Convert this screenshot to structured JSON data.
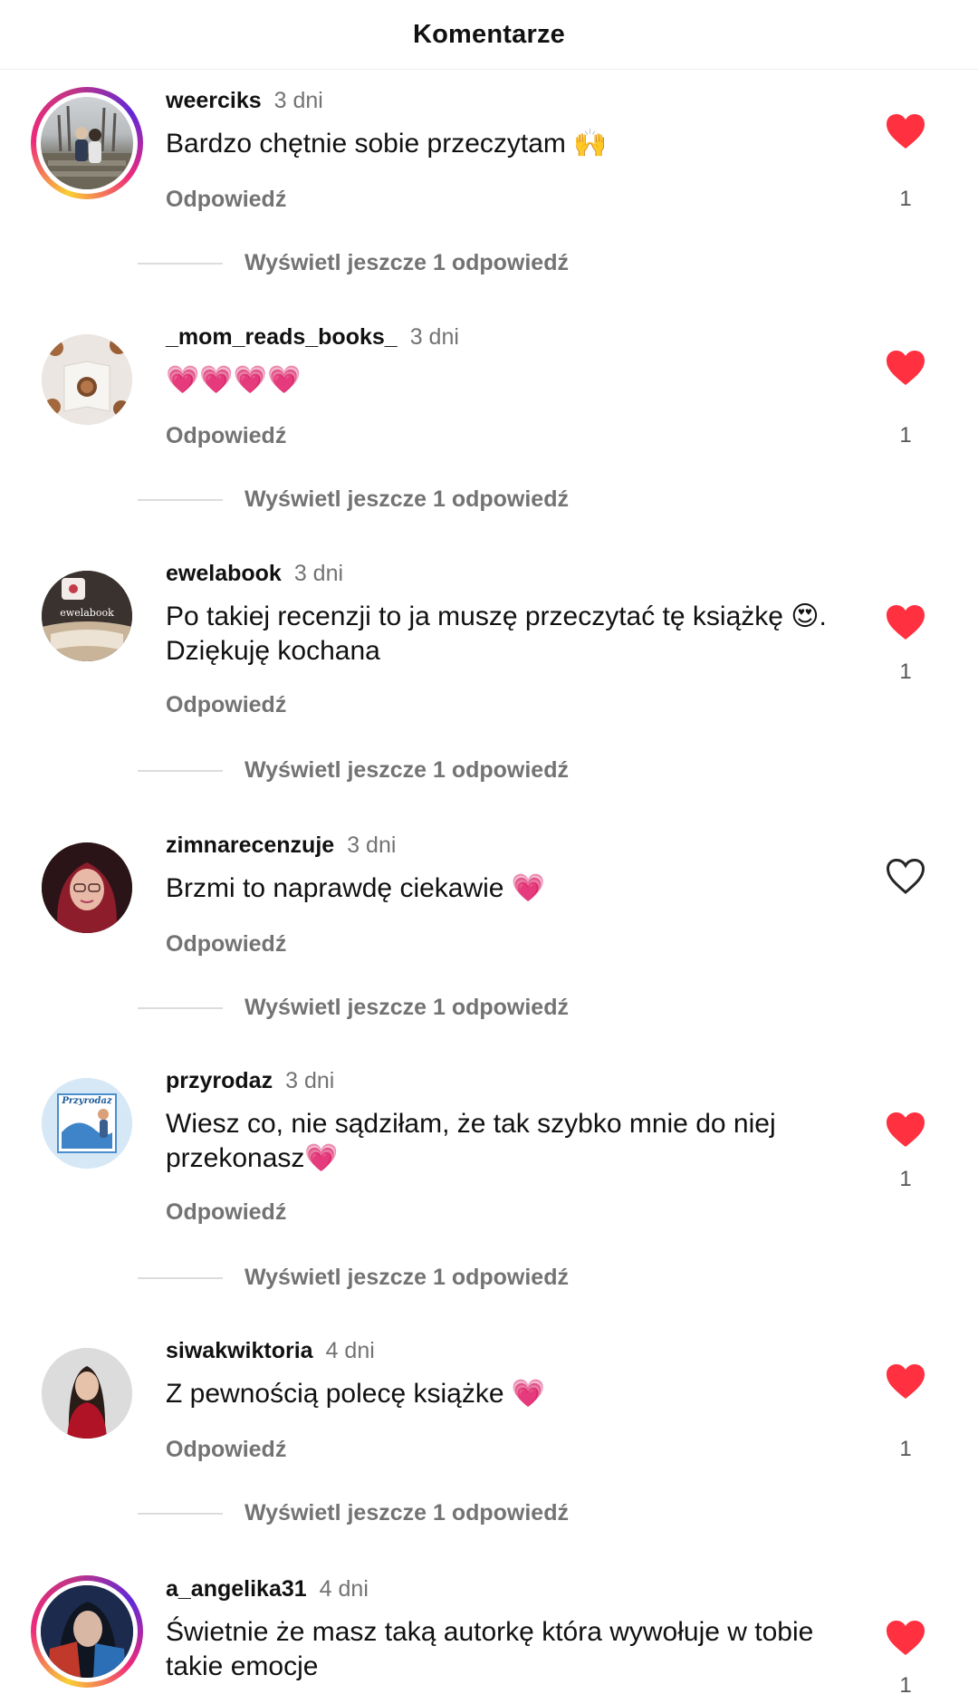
{
  "header": {
    "title": "Komentarze"
  },
  "reply_label": "Odpowiedź",
  "thread_label": "Wyświetl jeszcze 1 odpowiedź",
  "colors": {
    "like_active": "#ff3040",
    "like_inactive": "#262626",
    "secondary_text": "#737373",
    "story_ring": "#ee2a7b"
  },
  "comments": [
    {
      "username": "weerciks",
      "time": "3 dni",
      "text": "Bardzo chętnie sobie przeczytam 🙌",
      "liked": true,
      "likes": "1"
    },
    {
      "username": "_mom_reads_books_",
      "time": "3 dni",
      "text": "💗💗💗💗",
      "liked": true,
      "likes": "1"
    },
    {
      "username": "ewelabook",
      "time": "3 dni",
      "text": "Po takiej recenzji to ja muszę przeczytać tę książkę 😍. Dziękuję kochana",
      "liked": true,
      "likes": "1",
      "avatar_text": "ewelabook"
    },
    {
      "username": "zimnarecenzuje",
      "time": "3 dni",
      "text": "Brzmi to naprawdę ciekawie 💗",
      "liked": false,
      "likes": ""
    },
    {
      "username": "przyrodaz",
      "time": "3 dni",
      "text": "Wiesz co, nie sądziłam, że tak szybko mnie do niej przekonasz💗",
      "liked": true,
      "likes": "1",
      "avatar_text": "Przyrodaz"
    },
    {
      "username": "siwakwiktoria",
      "time": "4 dni",
      "text": "Z pewnością polecę książke 💗",
      "liked": true,
      "likes": "1"
    },
    {
      "username": "a_angelika31",
      "time": "4 dni",
      "text": "Świetnie że masz taką autorkę która wywołuje w tobie takie emocje",
      "liked": true,
      "likes": "1"
    }
  ]
}
